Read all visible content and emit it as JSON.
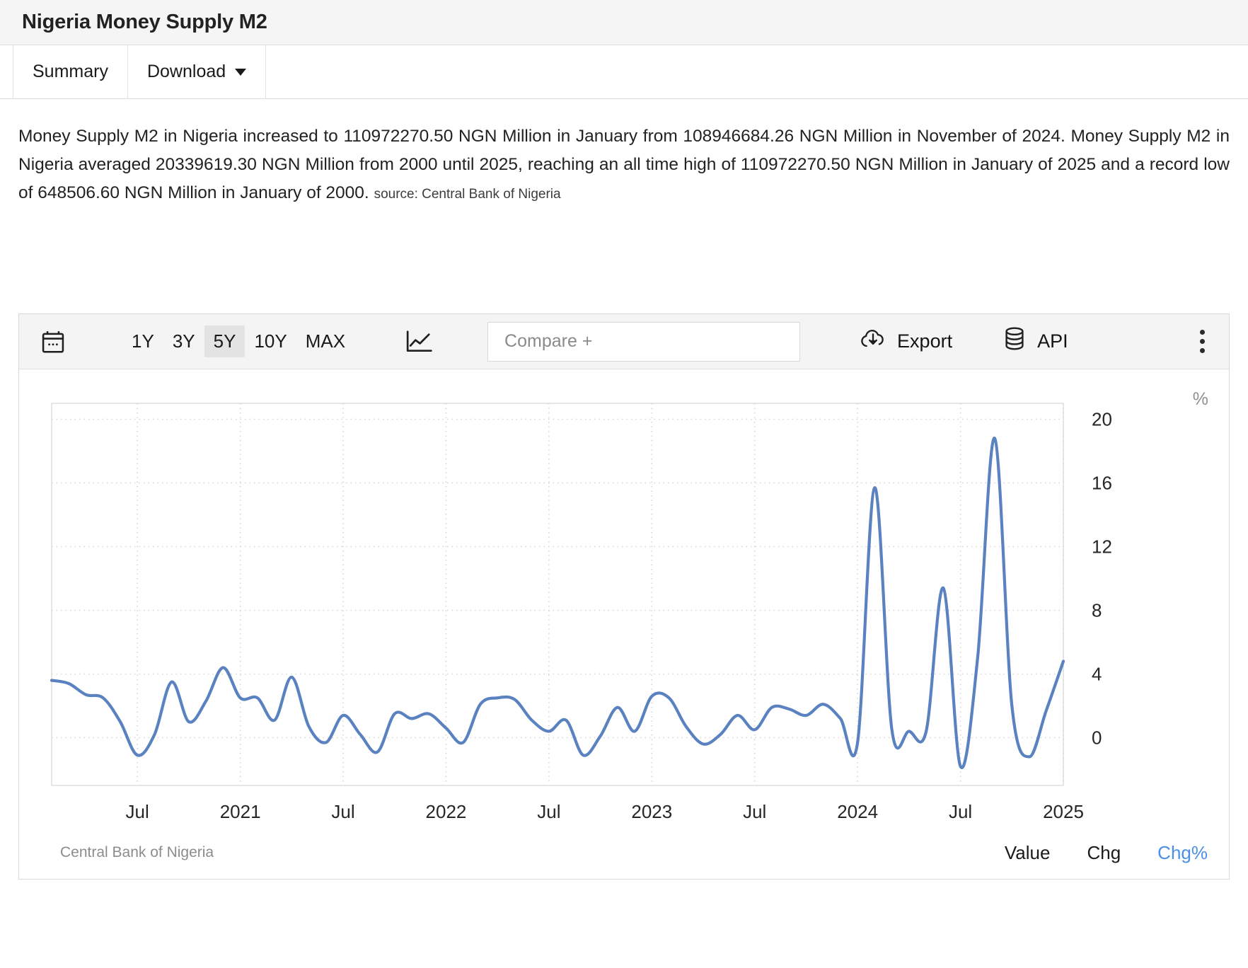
{
  "header": {
    "title": "Nigeria Money Supply M2"
  },
  "tabs": [
    {
      "label": "Summary",
      "name": "tab-summary",
      "active": true
    },
    {
      "label": "Download",
      "name": "tab-download",
      "active": false,
      "caret": true
    }
  ],
  "description": {
    "text": "Money Supply M2 in Nigeria increased to 110972270.50 NGN Million in January from 108946684.26 NGN Million in November of 2024. Money Supply M2 in Nigeria averaged 20339619.30 NGN Million from 2000 until 2025, reaching an all time high of 110972270.50 NGN Million in January of 2025 and a record low of 648506.60 NGN Million in January of 2000.",
    "source": "source: Central Bank of Nigeria"
  },
  "toolbar": {
    "calendar_icon": "calendar-icon",
    "ranges": [
      {
        "label": "1Y",
        "active": false
      },
      {
        "label": "3Y",
        "active": false
      },
      {
        "label": "5Y",
        "active": true
      },
      {
        "label": "10Y",
        "active": false
      },
      {
        "label": "MAX",
        "active": false
      }
    ],
    "chart_type_icon": "line-chart-icon",
    "compare_placeholder": "Compare +",
    "compare_value": "",
    "export_label": "Export",
    "export_icon": "cloud-download-icon",
    "api_label": "API",
    "api_icon": "database-icon",
    "more_icon": "kebab-menu-icon"
  },
  "chart_footer": {
    "source": "Central Bank of Nigeria",
    "tabs": [
      {
        "label": "Value",
        "selected": false
      },
      {
        "label": "Chg",
        "selected": false
      },
      {
        "label": "Chg%",
        "selected": true
      }
    ]
  },
  "colors": {
    "line": "#5a82c0",
    "accent": "#4a90e8",
    "grid": "#d6d6d6",
    "axis": "#cccccc",
    "header_bg": "#f5f5f5",
    "toolbar_bg": "#f4f4f4"
  },
  "chart_data": {
    "type": "line",
    "title": "Nigeria Money Supply M2",
    "xlabel": "",
    "ylabel": "%",
    "unit": "%",
    "ylim": [
      -3,
      21
    ],
    "yticks": [
      0,
      4,
      8,
      12,
      16,
      20
    ],
    "grid": true,
    "legend_position": "bottom-right",
    "xtick_labels": [
      "Jul",
      "2021",
      "Jul",
      "2022",
      "Jul",
      "2023",
      "Jul",
      "2024",
      "Jul",
      "2025"
    ],
    "xtick_x": [
      "2020-07",
      "2021-01",
      "2021-07",
      "2022-01",
      "2022-07",
      "2023-01",
      "2023-07",
      "2024-01",
      "2024-07",
      "2025-01"
    ],
    "series": [
      {
        "name": "Chg%",
        "color": "#5a82c0",
        "x": [
          "2020-02",
          "2020-03",
          "2020-04",
          "2020-05",
          "2020-06",
          "2020-07",
          "2020-08",
          "2020-09",
          "2020-10",
          "2020-11",
          "2020-12",
          "2021-01",
          "2021-02",
          "2021-03",
          "2021-04",
          "2021-05",
          "2021-06",
          "2021-07",
          "2021-08",
          "2021-09",
          "2021-10",
          "2021-11",
          "2021-12",
          "2022-01",
          "2022-02",
          "2022-03",
          "2022-04",
          "2022-05",
          "2022-06",
          "2022-07",
          "2022-08",
          "2022-09",
          "2022-10",
          "2022-11",
          "2022-12",
          "2023-01",
          "2023-02",
          "2023-03",
          "2023-04",
          "2023-05",
          "2023-06",
          "2023-07",
          "2023-08",
          "2023-09",
          "2023-10",
          "2023-11",
          "2023-12",
          "2024-01",
          "2024-02",
          "2024-03",
          "2024-04",
          "2024-05",
          "2024-06",
          "2024-07",
          "2024-08",
          "2024-09",
          "2024-10",
          "2024-11",
          "2024-12",
          "2025-01"
        ],
        "values": [
          3.6,
          3.4,
          2.7,
          2.5,
          1.0,
          -1.1,
          0.2,
          3.5,
          1.0,
          2.3,
          4.4,
          2.5,
          2.5,
          1.1,
          3.8,
          0.7,
          -0.3,
          1.4,
          0.2,
          -0.9,
          1.5,
          1.2,
          1.5,
          0.6,
          -0.3,
          2.1,
          2.5,
          2.4,
          1.1,
          0.4,
          1.1,
          -1.1,
          0.1,
          1.9,
          0.4,
          2.6,
          2.5,
          0.7,
          -0.4,
          0.2,
          1.4,
          0.5,
          1.9,
          1.8,
          1.4,
          2.1,
          1.2,
          -0.3,
          15.7,
          0.5,
          0.4,
          0.4,
          9.4,
          -1.8,
          5.0,
          18.8,
          2.0,
          -1.2,
          1.7,
          4.8
        ]
      }
    ]
  }
}
